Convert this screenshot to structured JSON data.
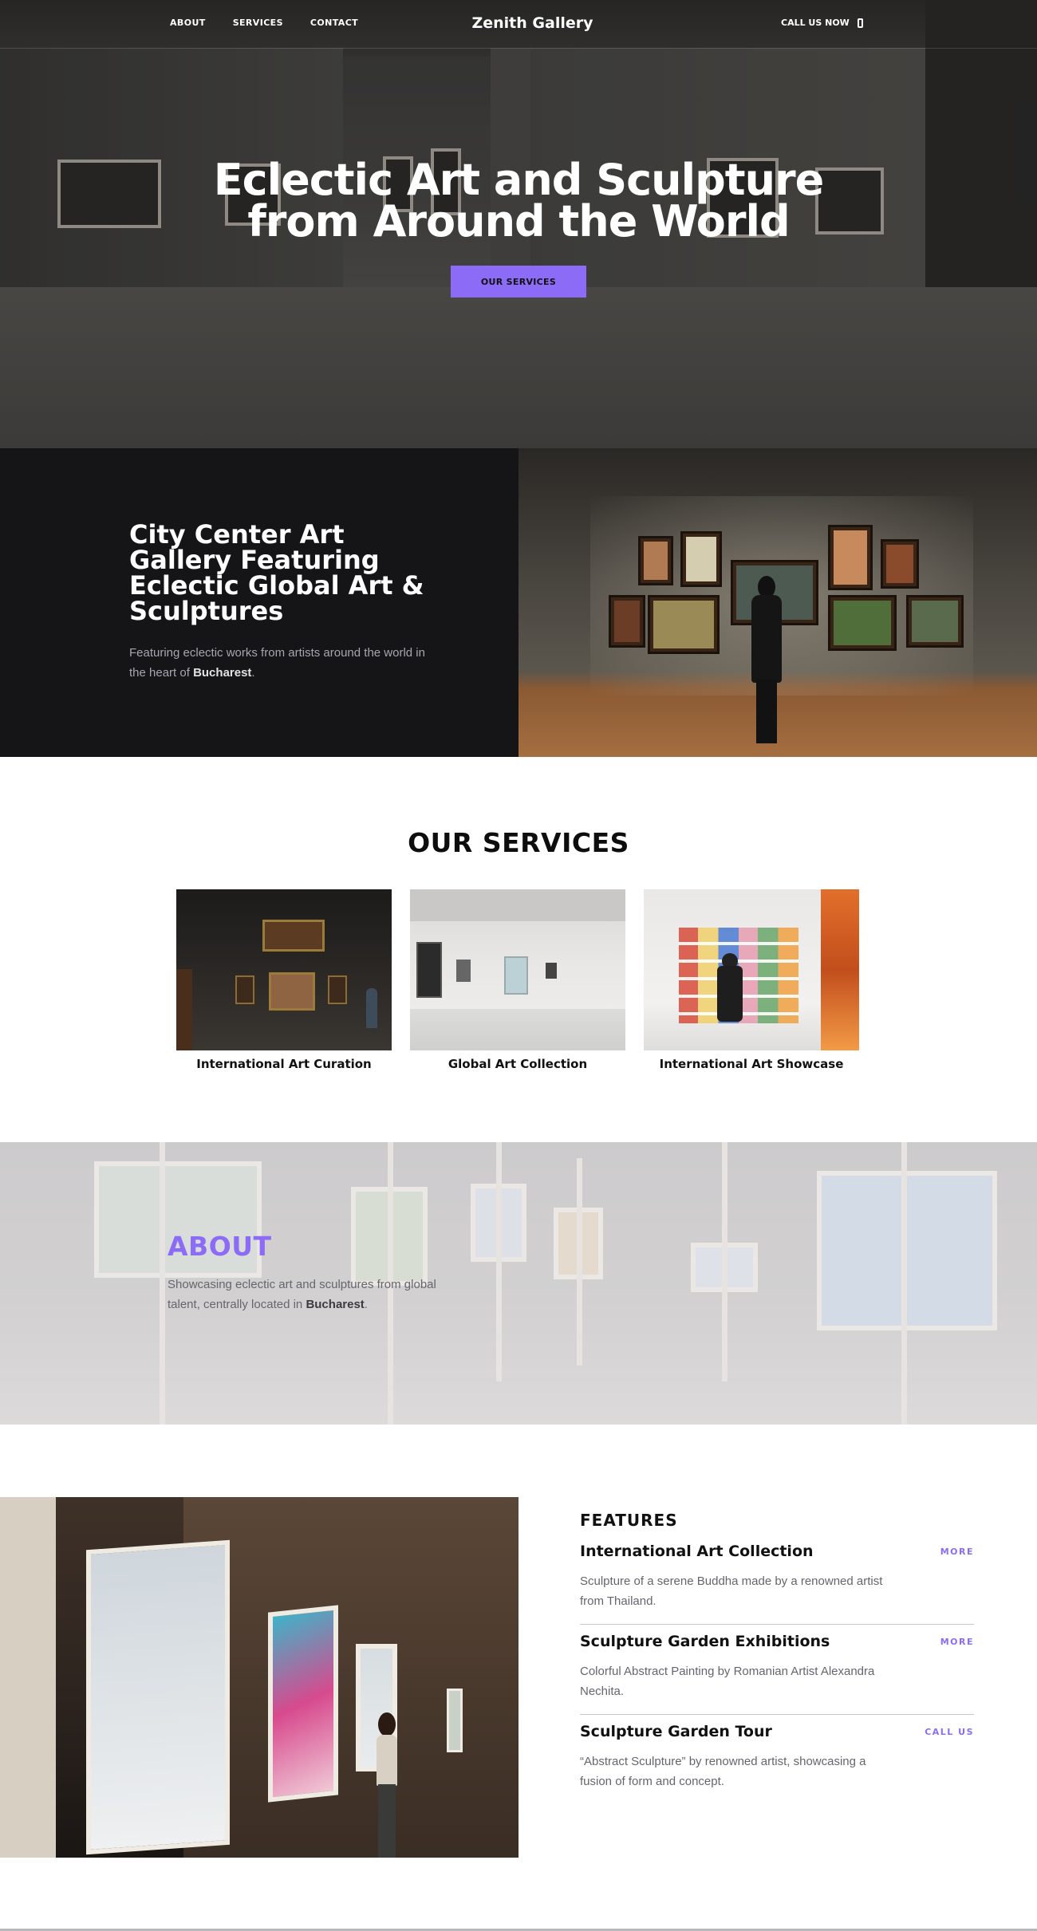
{
  "nav": {
    "links": [
      "ABOUT",
      "SERVICES",
      "CONTACT"
    ],
    "brand": "Zenith Gallery",
    "call": "CALL US NOW"
  },
  "hero": {
    "title_line1": "Eclectic Art and Sculpture",
    "title_line2": "from Around the World",
    "button": "OUR SERVICES"
  },
  "city": {
    "title": "City Center Art Gallery Featuring Eclectic Global Art & Sculptures",
    "desc_prefix": "Featuring eclectic works from artists around the world in the heart of ",
    "desc_bold": "Bucharest",
    "desc_suffix": "."
  },
  "services": {
    "title": "OUR SERVICES",
    "items": [
      {
        "caption": "International Art Curation"
      },
      {
        "caption": "Global Art Collection"
      },
      {
        "caption": "International Art Showcase"
      }
    ]
  },
  "about": {
    "title": "ABOUT",
    "desc_prefix": "Showcasing eclectic art and sculptures from global talent, centrally located in ",
    "desc_bold": "Bucharest",
    "desc_suffix": "."
  },
  "features": {
    "title": "FEATURES",
    "items": [
      {
        "name": "International Art Collection",
        "link": "MORE",
        "desc": "Sculpture of a serene Buddha made by a renowned artist from Thailand."
      },
      {
        "name": "Sculpture Garden Exhibitions",
        "link": "MORE",
        "desc": "Colorful Abstract Painting by Romanian Artist Alexandra Nechita."
      },
      {
        "name": "Sculpture Garden Tour",
        "link": "CALL US",
        "desc": "“Abstract Sculpture” by renowned artist, showcasing a fusion of form and concept."
      }
    ]
  },
  "colors": {
    "accent": "#8c6cf6",
    "dark_bg": "#151518"
  }
}
